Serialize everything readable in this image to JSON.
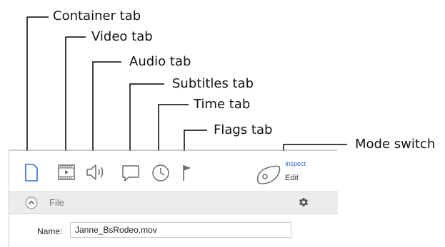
{
  "callouts": {
    "container_tab": "Container tab",
    "video_tab": "Video tab",
    "audio_tab": "Audio tab",
    "subtitles_tab": "Subtitles tab",
    "time_tab": "Time tab",
    "flags_tab": "Flags tab",
    "mode_switch": "Mode switch"
  },
  "toolbar": {
    "tabs": [
      {
        "name": "container",
        "icon": "document-icon",
        "selected": true
      },
      {
        "name": "video",
        "icon": "film-icon",
        "selected": false
      },
      {
        "name": "audio",
        "icon": "speaker-icon",
        "selected": false
      },
      {
        "name": "subtitles",
        "icon": "speech-bubble-icon",
        "selected": false
      },
      {
        "name": "time",
        "icon": "clock-icon",
        "selected": false
      },
      {
        "name": "flags",
        "icon": "flag-icon",
        "selected": false
      }
    ],
    "mode": {
      "inspect_label": "Inspect",
      "edit_label": "Edit",
      "icon": "inspect-edit-icon"
    }
  },
  "file_section": {
    "title": "File",
    "collapse_icon": "chevron-up-circle-icon",
    "settings_icon": "gear-icon",
    "name_label": "Name:",
    "name_value": "Janne_BsRodeo.mov"
  },
  "colors": {
    "accent": "#2f6fd6",
    "icon_gray": "#6b6b6b",
    "section_bar": "#ececec"
  }
}
